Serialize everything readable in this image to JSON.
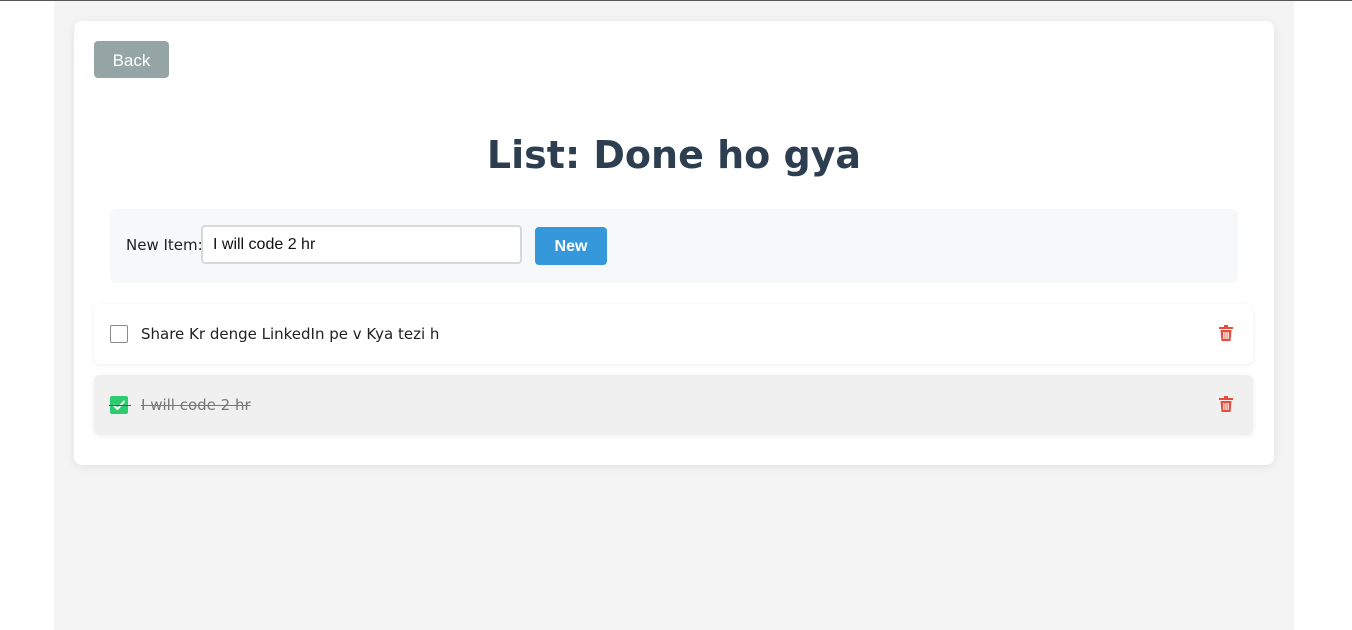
{
  "navigation": {
    "back_label": "Back"
  },
  "page": {
    "title": "List: Done ho gya"
  },
  "form": {
    "label": "New Item:",
    "input_value": "I will code 2 hr",
    "button_label": "New"
  },
  "items": [
    {
      "text": "Share Kr denge LinkedIn pe v Kya tezi h",
      "checked": false
    },
    {
      "text": "I will code 2 hr",
      "checked": true
    }
  ],
  "icons": {
    "delete": "trash-icon",
    "check": "checkmark-icon"
  },
  "colors": {
    "back_button": "#95a5a6",
    "new_button": "#3498db",
    "title": "#2c3e50",
    "checkbox_checked": "#2ecc71",
    "delete_icon": "#e74c3c",
    "checked_row_bg": "#f0f0f0"
  }
}
